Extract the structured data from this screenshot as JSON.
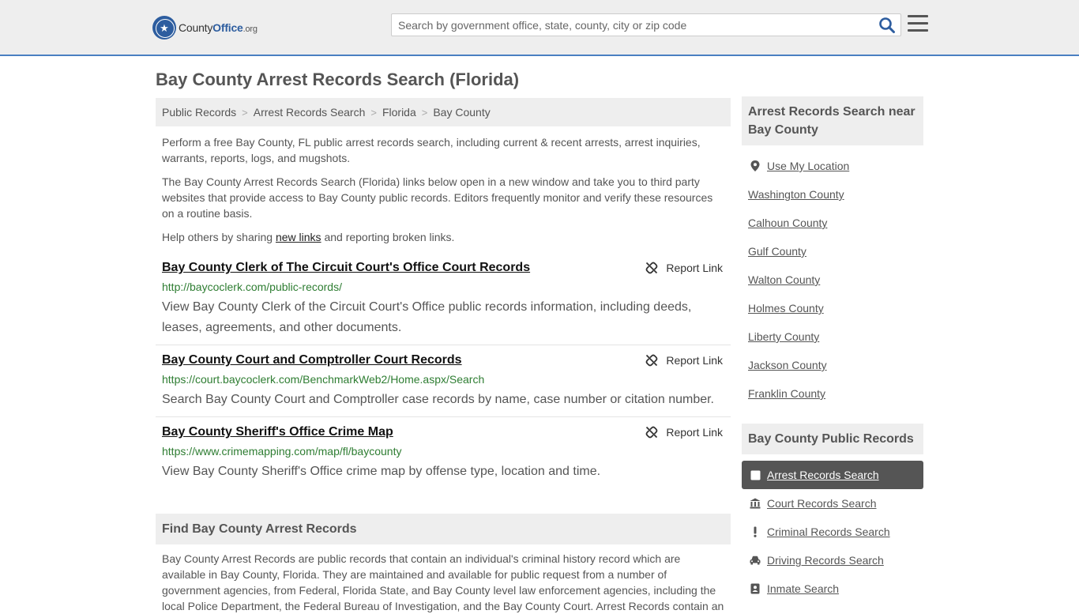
{
  "header": {
    "logo_county": "County",
    "logo_office": "Office",
    "logo_org": ".org",
    "search_placeholder": "Search by government office, state, county, city or zip code"
  },
  "page_title": "Bay County Arrest Records Search (Florida)",
  "breadcrumb": [
    "Public Records",
    "Arrest Records Search",
    "Florida",
    "Bay County"
  ],
  "intro": {
    "p1": "Perform a free Bay County, FL public arrest records search, including current & recent arrests, arrest inquiries, warrants, reports, logs, and mugshots.",
    "p2": "The Bay County Arrest Records Search (Florida) links below open in a new window and take you to third party websites that provide access to Bay County public records. Editors frequently monitor and verify these resources on a routine basis.",
    "p3_before": "Help others by sharing ",
    "p3_link": "new links",
    "p3_after": " and reporting broken links."
  },
  "report_label": "Report Link",
  "records": [
    {
      "title": "Bay County Clerk of The Circuit Court's Office Court Records",
      "url": "http://baycoclerk.com/public-records/",
      "desc": "View Bay County Clerk of the Circuit Court's Office public records information, including deeds, leases, agreements, and other documents."
    },
    {
      "title": "Bay County Court and Comptroller Court Records",
      "url": "https://court.baycoclerk.com/BenchmarkWeb2/Home.aspx/Search",
      "desc": "Search Bay County Court and Comptroller case records by name, case number or citation number."
    },
    {
      "title": "Bay County Sheriff's Office Crime Map",
      "url": "https://www.crimemapping.com/map/fl/baycounty",
      "desc": "View Bay County Sheriff's Office crime map by offense type, location and time."
    }
  ],
  "find": {
    "heading": "Find Bay County Arrest Records",
    "text": "Bay County Arrest Records are public records that contain an individual's criminal history record which are available in Bay County, Florida. They are maintained and available for public request from a number of government agencies, from Federal, Florida State, and Bay County level law enforcement agencies, including the local Police Department, the Federal Bureau of Investigation, and the Bay County Court. Arrest Records contain an"
  },
  "sidebar": {
    "near_heading": "Arrest Records Search near Bay County",
    "use_location": "Use My Location",
    "nearby": [
      "Washington County",
      "Calhoun County",
      "Gulf County",
      "Walton County",
      "Holmes County",
      "Liberty County",
      "Jackson County",
      "Franklin County"
    ],
    "public_heading": "Bay County Public Records",
    "public_items": [
      {
        "label": "Arrest Records Search",
        "icon": "square-icon",
        "active": true
      },
      {
        "label": "Court Records Search",
        "icon": "courthouse-icon",
        "active": false
      },
      {
        "label": "Criminal Records Search",
        "icon": "exclamation-icon",
        "active": false
      },
      {
        "label": "Driving Records Search",
        "icon": "car-icon",
        "active": false
      },
      {
        "label": "Inmate Search",
        "icon": "id-badge-icon",
        "active": false
      }
    ]
  },
  "colors": {
    "header_bg": "#eeeeee",
    "header_border": "#4a7fc1",
    "brand_blue": "#2d5d9f",
    "url_green": "#2e7d32",
    "active_item_bg": "#555555",
    "search_icon": "#2d5d9f"
  }
}
